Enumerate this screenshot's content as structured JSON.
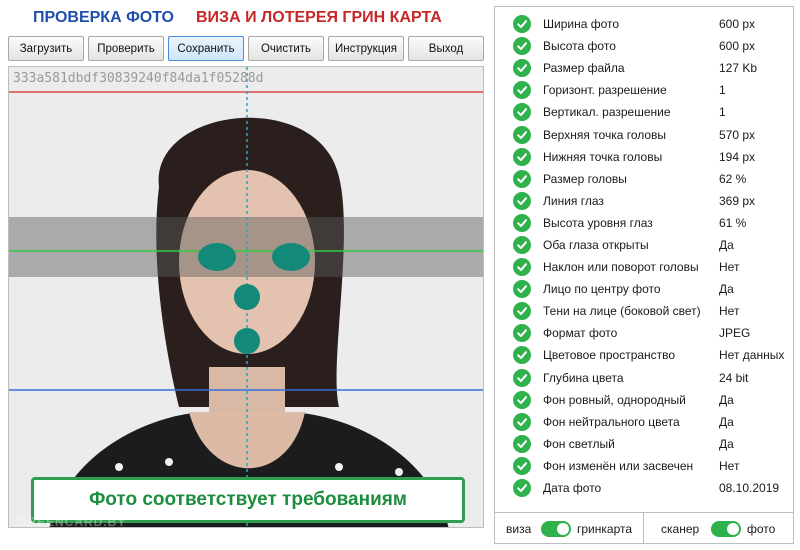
{
  "header": {
    "title_left": "ПРОВЕРКА ФОТО",
    "title_right": "ВИЗА И ЛОТЕРЕЯ ГРИН КАРТА"
  },
  "toolbar": {
    "load": "Загрузить",
    "check": "Проверить",
    "save": "Сохранить",
    "clear": "Очистить",
    "manual": "Инструкция",
    "exit": "Выход"
  },
  "photo": {
    "hash": "333a581dbdf30839240f84da1f05288d",
    "verdict": "Фото соответствует требованиям",
    "watermark": "GREENCARD.BY"
  },
  "checks": [
    {
      "label": "Ширина фото",
      "value": "600 px"
    },
    {
      "label": "Высота фото",
      "value": "600 px"
    },
    {
      "label": "Размер файла",
      "value": "127 Kb"
    },
    {
      "label": "Горизонт. разрешение",
      "value": "1"
    },
    {
      "label": "Вертикал. разрешение",
      "value": "1"
    },
    {
      "label": "Верхняя точка головы",
      "value": "570 px"
    },
    {
      "label": "Нижняя точка головы",
      "value": "194 px"
    },
    {
      "label": "Размер головы",
      "value": "62 %"
    },
    {
      "label": "Линия глаз",
      "value": "369 px"
    },
    {
      "label": "Высота уровня глаз",
      "value": "61 %"
    },
    {
      "label": "Оба глаза открыты",
      "value": "Да"
    },
    {
      "label": "Наклон или поворот головы",
      "value": "Нет"
    },
    {
      "label": "Лицо по центру фото",
      "value": "Да"
    },
    {
      "label": "Тени на лице (боковой свет)",
      "value": "Нет"
    },
    {
      "label": "Формат фото",
      "value": "JPEG"
    },
    {
      "label": "Цветовое пространство",
      "value": "Нет данных"
    },
    {
      "label": "Глубина цвета",
      "value": "24 bit"
    },
    {
      "label": "Фон ровный, однородный",
      "value": "Да"
    },
    {
      "label": "Фон нейтрального цвета",
      "value": "Да"
    },
    {
      "label": "Фон светлый",
      "value": "Да"
    },
    {
      "label": "Фон изменён или засвечен",
      "value": "Нет"
    },
    {
      "label": "Дата фото",
      "value": "08.10.2019"
    }
  ],
  "toggles": {
    "visa": "виза",
    "greencard": "гринкарта",
    "scanner": "сканер",
    "photo": "фото"
  },
  "colors": {
    "ok": "#2fb24c",
    "title_blue": "#1f4fa8",
    "title_red": "#c62828",
    "marker": "#13897a",
    "top_line": "#d94a4a",
    "eye_line": "#2ecc40",
    "chin_line": "#3a6fd8",
    "center_line": "#2aa6b8"
  }
}
